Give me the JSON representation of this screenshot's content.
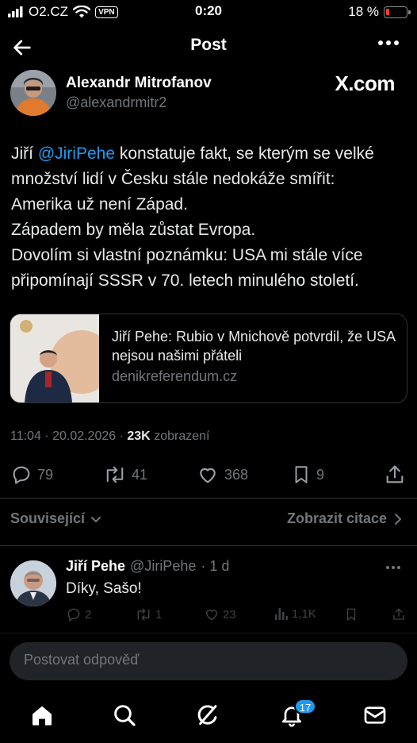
{
  "status_bar": {
    "carrier": "O2.CZ",
    "vpn": "VPN",
    "time": "0:20",
    "battery": "18 %",
    "battery_level": 0.18
  },
  "header": {
    "title": "Post"
  },
  "post": {
    "author_name": "Alexandr Mitrofanov",
    "author_handle": "@alexandrmitr2",
    "watermark": "X.com",
    "text": {
      "line1_prefix": "Jiří ",
      "mention": "@JiriPehe",
      "line1_suffix": " konstatuje fakt, se kterým se velké",
      "line2": "množství lidí v Česku stále nedokáže smířit:",
      "line3": "Amerika už není Západ.",
      "line4": "Západem by měla zůstat  Evropa.",
      "line5": "Dovolím si vlastní poznámku: USA mi stále více",
      "line6": "připomínají SSSR v 70. letech minulého století."
    },
    "card": {
      "title": "Jiří Pehe: Rubio v Mnichově potvrdil, že USA nejsou našimi přáteli",
      "domain": "denikreferendum.cz"
    },
    "timestamp": "11:04 · 20.02.2026 · ",
    "views_count": "23K",
    "views_label": "zobrazení",
    "actions": {
      "replies": "79",
      "reposts": "41",
      "likes": "368",
      "bookmarks": "9"
    },
    "related_label": "Související",
    "quotes_label": "Zobrazit citace"
  },
  "reply": {
    "name": "Jiří Pehe",
    "handle": "@JiriPehe",
    "age": "· 1 d",
    "text": "Díky, Sašo!",
    "actions": {
      "replies": "2",
      "reposts": "1",
      "likes": "23",
      "views": "1,1K"
    }
  },
  "compose": {
    "placeholder": "Postovat odpověď"
  },
  "tabbar": {
    "notifications_badge": "17"
  },
  "colors": {
    "background": "#000000",
    "accent": "#1d9bf0",
    "text": "#e7e9ea",
    "muted": "#71767b",
    "battery_low": "#ff3b30"
  }
}
